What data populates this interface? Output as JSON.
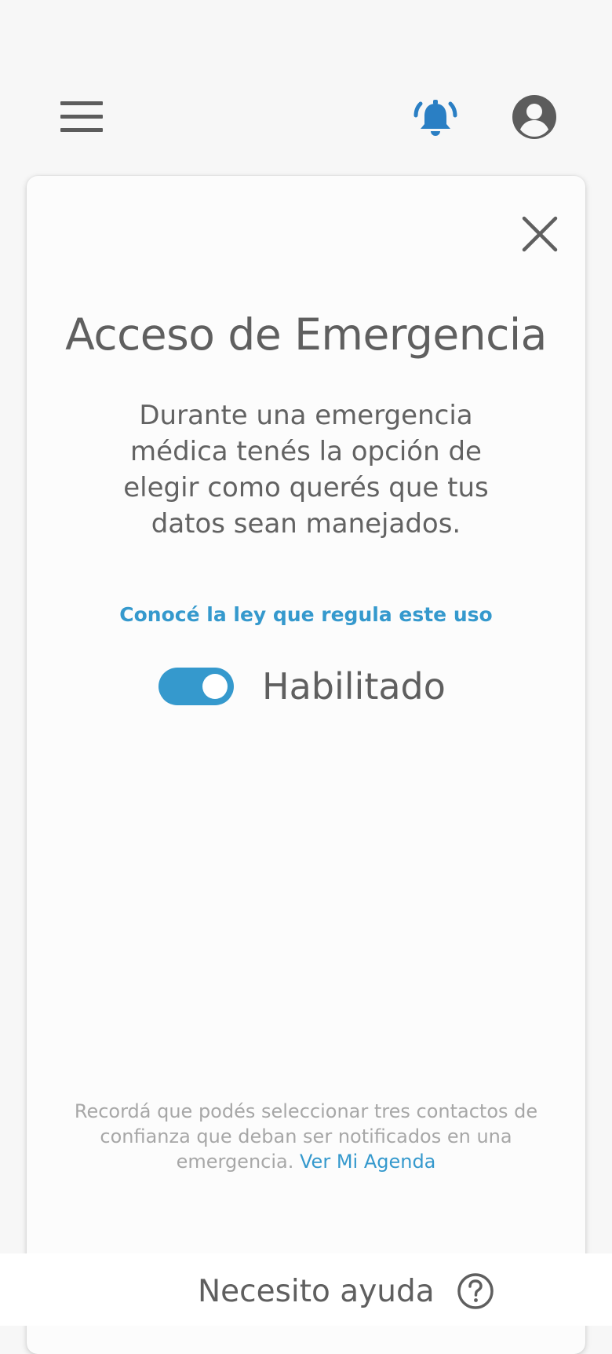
{
  "header": {
    "menu_icon": "hamburger-menu-icon",
    "alert_icon": "emergency-bell-icon",
    "account_icon": "account-circle-icon",
    "alert_color": "#2a7fc4"
  },
  "modal": {
    "title": "Acceso de Emergencia",
    "description": "Durante una emergencia médica tenés la opción de elegir como querés que tus datos sean manejados.",
    "law_link": "Conocé la ley que regula este uso",
    "toggle": {
      "label": "Habilitado",
      "enabled": true,
      "color": "#3599cd"
    },
    "footer_note": "Recordá que podés seleccionar tres contactos de confianza que deban ser notificados en una emergencia.",
    "agenda_link": "Ver Mi Agenda"
  },
  "bottom": {
    "help_label": "Necesito ayuda",
    "help_icon": "help-circle-icon"
  }
}
